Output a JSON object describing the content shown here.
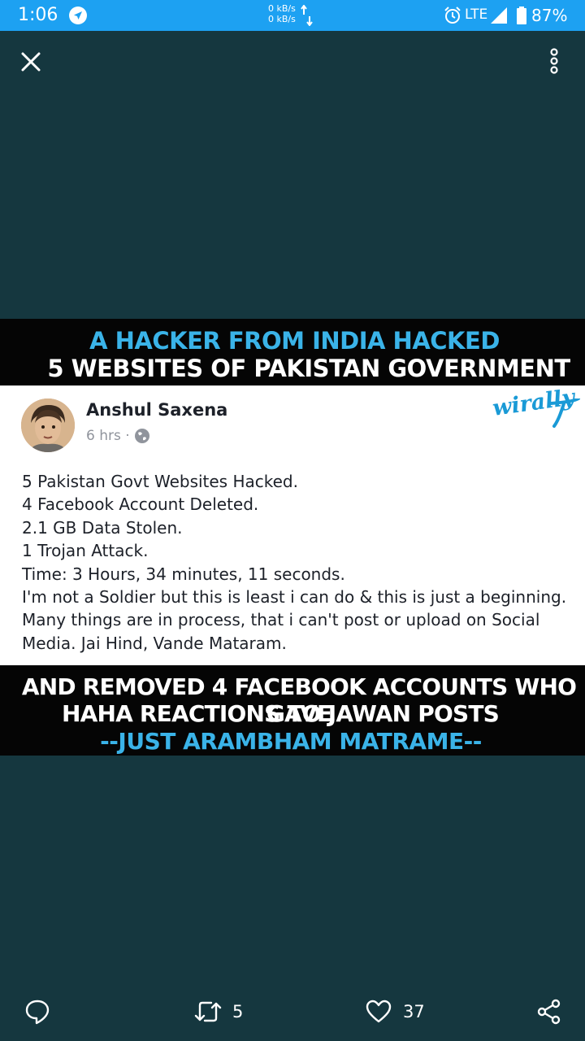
{
  "status_bar": {
    "time": "1:06",
    "net_up": "0 kB/s",
    "net_down": "0 kB/s",
    "network": "LTE",
    "battery": "87%",
    "icons": [
      "navigation-icon",
      "alarm-icon",
      "signal-icon",
      "battery-icon"
    ]
  },
  "toolbar": {
    "close_icon": "close-icon",
    "more_icon": "more-vertical-icon"
  },
  "media": {
    "banner_top": {
      "line1": "A HACKER FROM INDIA HACKED",
      "line2": "5 WEBSITES OF PAKISTAN GOVERNMENT"
    },
    "post": {
      "author": "Anshul Saxena",
      "time": "6 hrs ·",
      "watermark": "wirally",
      "lines": [
        "5 Pakistan Govt Websites Hacked.",
        "4 Facebook Account Deleted.",
        "2.1 GB  Data Stolen.",
        "1 Trojan Attack.",
        "Time: 3 Hours, 34 minutes, 11 seconds.",
        "I'm not a Soldier but this is least i can do & this is just a beginning.",
        "Many things are in process, that i can't post or upload on Social",
        "Media. Jai Hind, Vande Mataram."
      ]
    },
    "banner_bottom": {
      "line1": "AND REMOVED 4 FACEBOOK ACCOUNTS WHO GAVE",
      "line2": "HAHA REACTIONS TO JAWAN POSTS",
      "line3": "--JUST ARAMBHAM MATRAME--"
    }
  },
  "actions": {
    "reply_icon": "reply-icon",
    "retweet_count": "5",
    "like_count": "37",
    "share_icon": "share-icon"
  },
  "colors": {
    "background": "#15373f",
    "status_bar": "#1da1f2",
    "banner_accent": "#3ab3e8"
  }
}
